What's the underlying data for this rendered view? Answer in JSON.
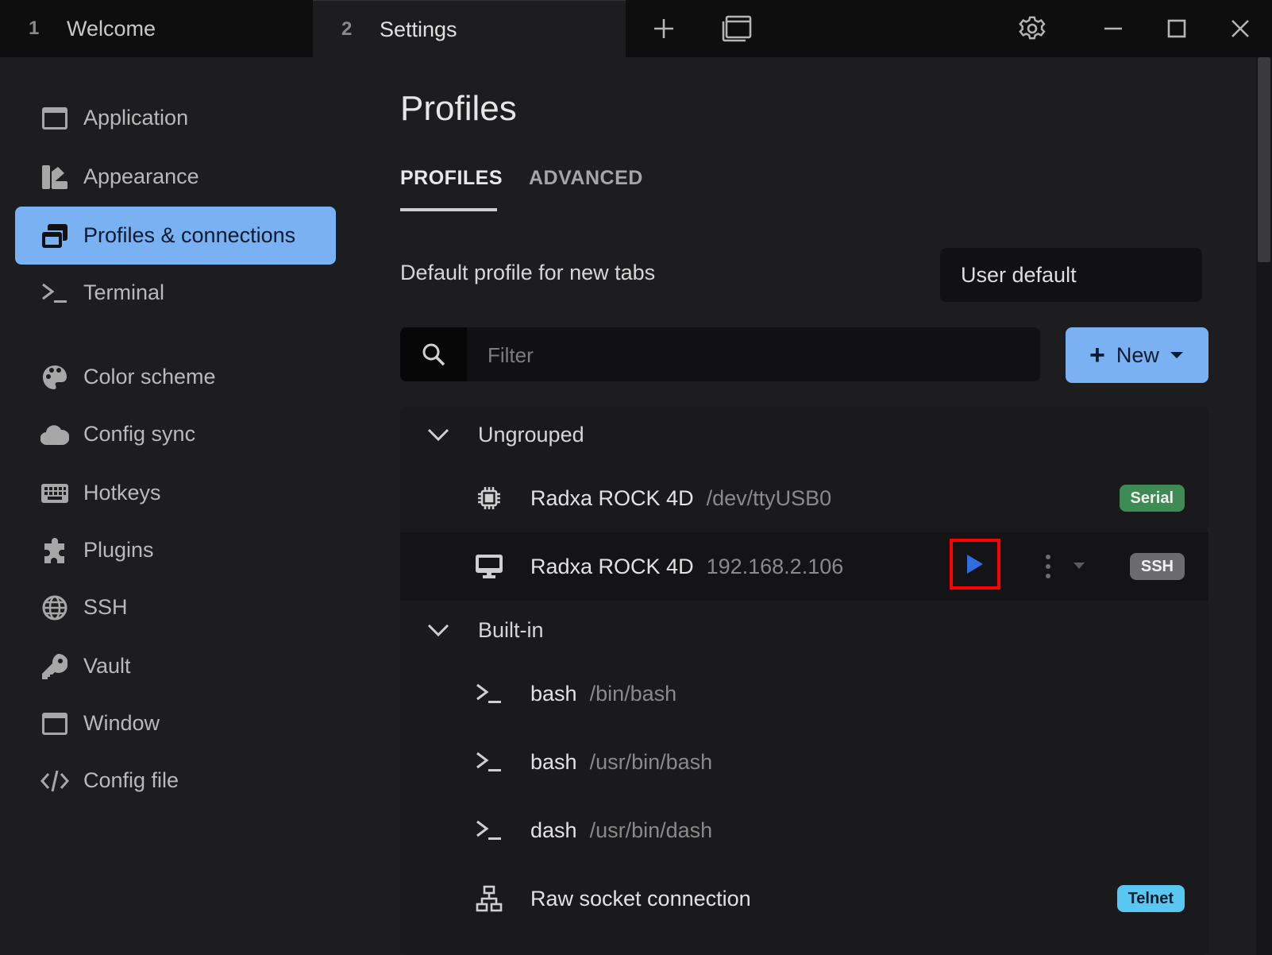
{
  "titlebar": {
    "tabs": [
      {
        "num": "1",
        "label": "Welcome"
      },
      {
        "num": "2",
        "label": "Settings"
      }
    ],
    "icons": [
      "plus-icon",
      "window-icon",
      "gear-icon",
      "minimize-icon",
      "maximize-icon",
      "close-icon"
    ]
  },
  "sidebar": {
    "items": [
      {
        "label": "Application",
        "icon": "window-icon"
      },
      {
        "label": "Appearance",
        "icon": "palette-swatch-icon"
      },
      {
        "label": "Profiles & connections",
        "icon": "windows-stack-icon",
        "active": true
      },
      {
        "label": "Terminal",
        "icon": "terminal-icon"
      },
      {
        "label": "Color scheme",
        "icon": "palette-icon"
      },
      {
        "label": "Config sync",
        "icon": "cloud-icon"
      },
      {
        "label": "Hotkeys",
        "icon": "keyboard-icon"
      },
      {
        "label": "Plugins",
        "icon": "puzzle-icon"
      },
      {
        "label": "SSH",
        "icon": "globe-icon"
      },
      {
        "label": "Vault",
        "icon": "key-icon"
      },
      {
        "label": "Window",
        "icon": "window-icon"
      },
      {
        "label": "Config file",
        "icon": "code-icon"
      }
    ]
  },
  "main": {
    "title": "Profiles",
    "tabs": [
      {
        "label": "PROFILES"
      },
      {
        "label": "ADVANCED"
      }
    ],
    "default_profile": {
      "label": "Default profile for new tabs",
      "value": "User default"
    },
    "filter": {
      "placeholder": "Filter",
      "value": ""
    },
    "new_button": {
      "label": "New"
    },
    "groups": [
      {
        "name": "Ungrouped",
        "profiles": [
          {
            "name": "Radxa ROCK 4D",
            "desc": "/dev/ttyUSB0",
            "icon": "chip-icon",
            "badge": "Serial"
          },
          {
            "name": "Radxa ROCK 4D",
            "desc": "192.168.2.106",
            "icon": "monitor-icon",
            "badge": "SSH"
          }
        ]
      },
      {
        "name": "Built-in",
        "profiles": [
          {
            "name": "bash",
            "desc": "/bin/bash",
            "icon": "terminal-icon"
          },
          {
            "name": "bash",
            "desc": "/usr/bin/bash",
            "icon": "terminal-icon"
          },
          {
            "name": "dash",
            "desc": "/usr/bin/dash",
            "icon": "terminal-icon"
          },
          {
            "name": "Raw socket connection",
            "desc": "",
            "icon": "network-icon",
            "badge": "Telnet"
          }
        ]
      }
    ]
  },
  "colors": {
    "accent": "#79b1f3",
    "background": "#1d1d1f",
    "highlight_box": "#ff0000",
    "serial_badge": "#3f8b55",
    "ssh_badge": "#6c6c70",
    "telnet_badge": "#58c8f3"
  }
}
